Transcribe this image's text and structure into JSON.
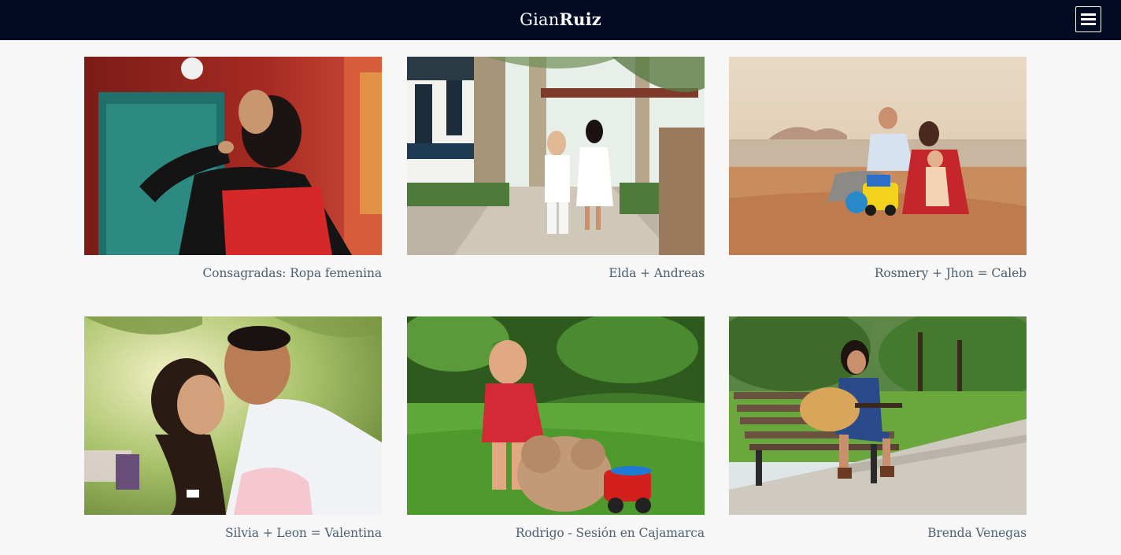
{
  "header": {
    "logo_light": "Gian",
    "logo_bold": "Ruiz",
    "background": "#020a24",
    "menu_icon": "hamburger-icon"
  },
  "gallery": {
    "items": [
      {
        "caption": "Consagradas: Ropa femenina"
      },
      {
        "caption": "Elda + Andreas"
      },
      {
        "caption": "Rosmery + Jhon = Caleb"
      },
      {
        "caption": "Silvia + Leon = Valentina"
      },
      {
        "caption": "Rodrigo - Sesión en Cajamarca"
      },
      {
        "caption": "Brenda Venegas"
      }
    ]
  },
  "colors": {
    "page_background": "#f7f7f7",
    "caption_text": "#4e6070"
  }
}
